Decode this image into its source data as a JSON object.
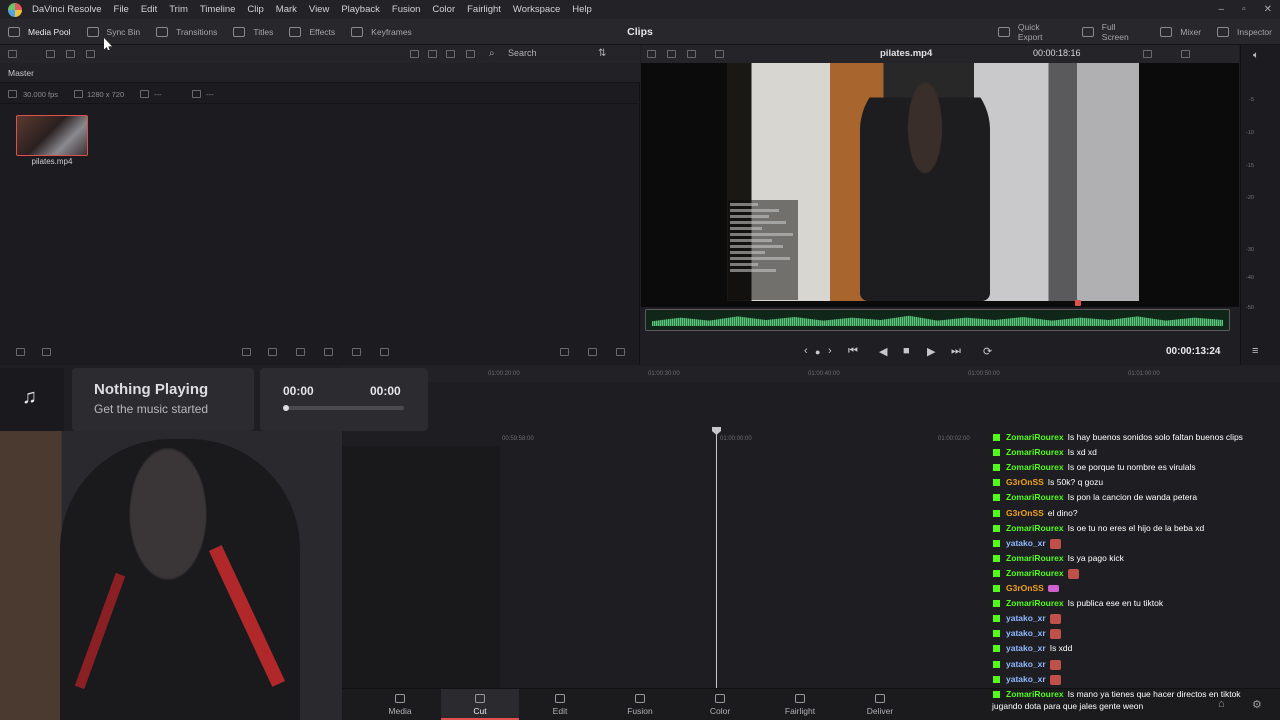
{
  "menubar": {
    "items": [
      "DaVinci Resolve",
      "File",
      "Edit",
      "Trim",
      "Timeline",
      "Clip",
      "Mark",
      "View",
      "Playback",
      "Fusion",
      "Color",
      "Fairlight",
      "Workspace",
      "Help"
    ]
  },
  "toolbar": {
    "media_pool": "Media Pool",
    "sync_bin": "Sync Bin",
    "transitions": "Transitions",
    "titles": "Titles",
    "effects": "Effects",
    "keyframes": "Keyframes",
    "clips_title": "Clips",
    "quick_export": "Quick Export",
    "full_screen": "Full Screen",
    "mixer": "Mixer",
    "inspector": "Inspector"
  },
  "media_pool": {
    "search_placeholder": "Search",
    "master_label": "Master",
    "fps": "30.000 fps",
    "resolution": "1280 x 720",
    "dash1": "---",
    "dash2": "---",
    "clip_name": "pilates.mp4"
  },
  "viewer": {
    "file_name": "pilates.mp4",
    "duration_tc": "00:00:18:16",
    "current_tc": "00:00:13:24",
    "db_marks": [
      "-5",
      "-10",
      "-15",
      "-20",
      "-30",
      "-40",
      "-50"
    ]
  },
  "timeline": {
    "ruler_upper": [
      "01:00:20:00",
      "01:00:30:00",
      "01:00:40:00",
      "01:00:50:00",
      "01:01:00:00"
    ],
    "ruler_lower": [
      "00:59:58:00",
      "01:00:00:00",
      "01:00:02:00"
    ]
  },
  "music": {
    "title": "Nothing Playing",
    "subtitle": "Get the music started",
    "time_start": "00:00",
    "time_end": "00:00"
  },
  "chat": {
    "user_colors": {
      "ZomariRourex": "#53fc18",
      "G3rOnSS": "#f0a020",
      "yatako_xr": "#8fb8ff"
    },
    "messages": [
      {
        "user": "ZomariRourex",
        "text": "Is hay buenos sonidos solo faltan buenos clips"
      },
      {
        "user": "ZomariRourex",
        "text": "Is xd xd"
      },
      {
        "user": "ZomariRourex",
        "text": "Is oe porque tu nombre es virulals"
      },
      {
        "user": "G3rOnSS",
        "text": "Is 50k? q gozu"
      },
      {
        "user": "ZomariRourex",
        "text": "Is pon la cancion de wanda petera"
      },
      {
        "user": "G3rOnSS",
        "text": "el dino?"
      },
      {
        "user": "ZomariRourex",
        "text": "Is oe tu no eres el hijo de la beba xd"
      },
      {
        "user": "yatako_xr",
        "text": ""
      },
      {
        "user": "ZomariRourex",
        "text": "Is ya pago kick"
      },
      {
        "user": "ZomariRourex",
        "text": ""
      },
      {
        "user": "G3rOnSS",
        "text": ""
      },
      {
        "user": "ZomariRourex",
        "text": "Is publica ese en tu tiktok"
      },
      {
        "user": "yatako_xr",
        "text": ""
      },
      {
        "user": "yatako_xr",
        "text": ""
      },
      {
        "user": "yatako_xr",
        "text": "Is xdd"
      },
      {
        "user": "yatako_xr",
        "text": ""
      },
      {
        "user": "yatako_xr",
        "text": ""
      },
      {
        "user": "ZomariRourex",
        "text": "Is mano ya tienes que hacer directos en tiktok"
      }
    ],
    "last_line_cont": "jugando dota para que jales gente weon"
  },
  "pagenav": [
    "Media",
    "Cut",
    "Edit",
    "Fusion",
    "Color",
    "Fairlight",
    "Deliver"
  ],
  "pagenav_active": "Cut"
}
